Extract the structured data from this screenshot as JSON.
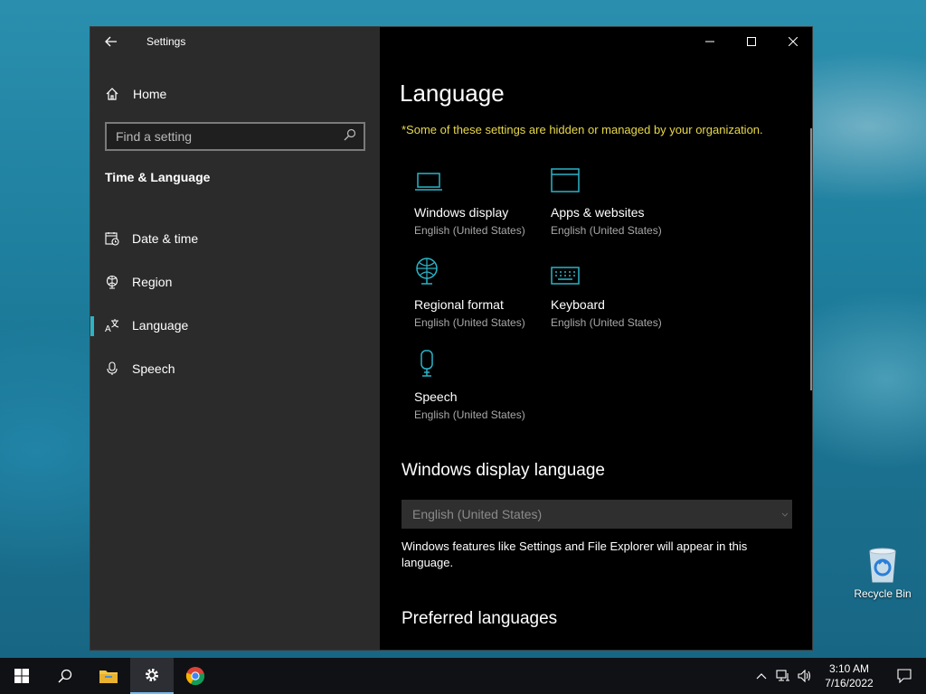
{
  "window": {
    "app_title": "Settings"
  },
  "sidebar": {
    "home_label": "Home",
    "search_placeholder": "Find a setting",
    "section_title": "Time & Language",
    "items": [
      {
        "label": "Date & time",
        "icon": "calendar-clock-icon"
      },
      {
        "label": "Region",
        "icon": "globe-icon"
      },
      {
        "label": "Language",
        "icon": "language-icon",
        "active": true
      },
      {
        "label": "Speech",
        "icon": "microphone-icon"
      }
    ]
  },
  "main": {
    "title": "Language",
    "notice": "*Some of these settings are hidden or managed by your organization.",
    "tiles": [
      {
        "title": "Windows display",
        "subtitle": "English (United States)",
        "icon": "laptop-icon"
      },
      {
        "title": "Apps & websites",
        "subtitle": "English (United States)",
        "icon": "browser-window-icon"
      },
      {
        "title": "Regional format",
        "subtitle": "English (United States)",
        "icon": "globe-icon"
      },
      {
        "title": "Keyboard",
        "subtitle": "English (United States)",
        "icon": "keyboard-icon"
      },
      {
        "title": "Speech",
        "subtitle": "English (United States)",
        "icon": "microphone-icon"
      }
    ],
    "display_language_heading": "Windows display language",
    "display_language_value": "English (United States)",
    "display_language_desc": "Windows features like Settings and File Explorer will appear in this language.",
    "preferred_heading": "Preferred languages"
  },
  "desktop": {
    "recycle_bin_label": "Recycle Bin"
  },
  "taskbar": {
    "time": "3:10 AM",
    "date": "7/16/2022"
  },
  "colors": {
    "accent": "#2ab4c8",
    "notice": "#e8d84a",
    "sidebar_bg": "#2b2b2b",
    "content_bg": "#000000"
  }
}
